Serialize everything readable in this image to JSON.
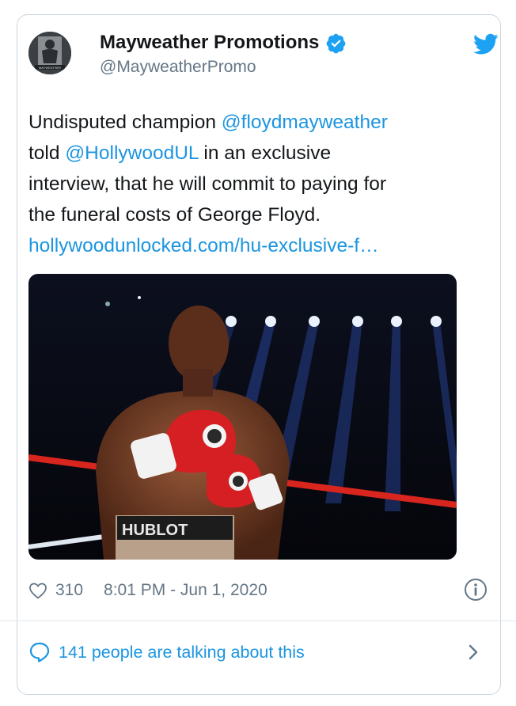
{
  "author": {
    "name": "Mayweather Promotions",
    "handle": "@MayweatherPromo",
    "avatar_label": "MAYWEATHER"
  },
  "tweet": {
    "line1_text": "Undisputed champion ",
    "mention1": "@floydmayweather",
    "line2_prefix": "told ",
    "mention2": "@HollywoodUL",
    "line2_suffix": " in an exclusive",
    "line3": "interview, that he will commit to paying for",
    "line4": "the funeral costs of George Floyd.",
    "link": "hollywoodunlocked.com/hu-exclusive-f…"
  },
  "photo": {
    "description_icon": "boxer-photo",
    "trunks_text": "HUBLOT"
  },
  "meta": {
    "likes": "310",
    "timestamp": "8:01 PM - Jun 1, 2020"
  },
  "footer": {
    "talking": "141 people are talking about this"
  },
  "colors": {
    "link": "#1b95e0",
    "secondary": "#657786",
    "border": "#ccd6dd",
    "verified": "#1da1f2"
  }
}
